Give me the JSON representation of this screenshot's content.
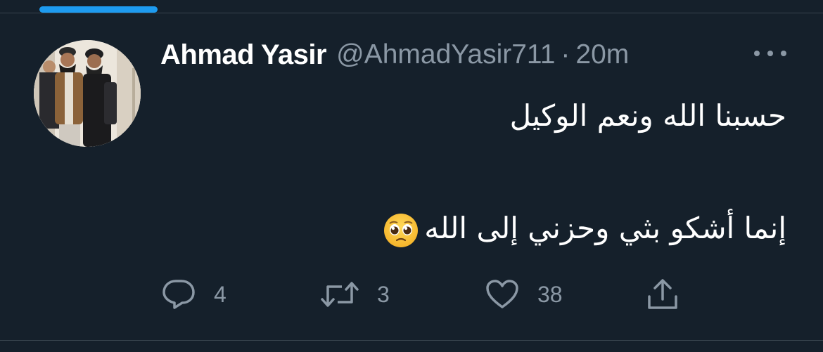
{
  "tweet": {
    "display_name": "Ahmad Yasir",
    "handle": "@AhmadYasir711",
    "separator": "·",
    "time": "20m",
    "text_line_1": "حسبنا الله ونعم الوكيل",
    "text_line_2": "إنما أشكو بثي وحزني إلى الله",
    "emoji": "pleading-face-emoji"
  },
  "actions": {
    "reply_count": "4",
    "retweet_count": "3",
    "like_count": "38",
    "share_icon": "share-icon"
  },
  "colors": {
    "background": "#15202b",
    "secondary_text": "#8b98a5",
    "divider": "#38444d",
    "accent": "#1d9bf0"
  }
}
